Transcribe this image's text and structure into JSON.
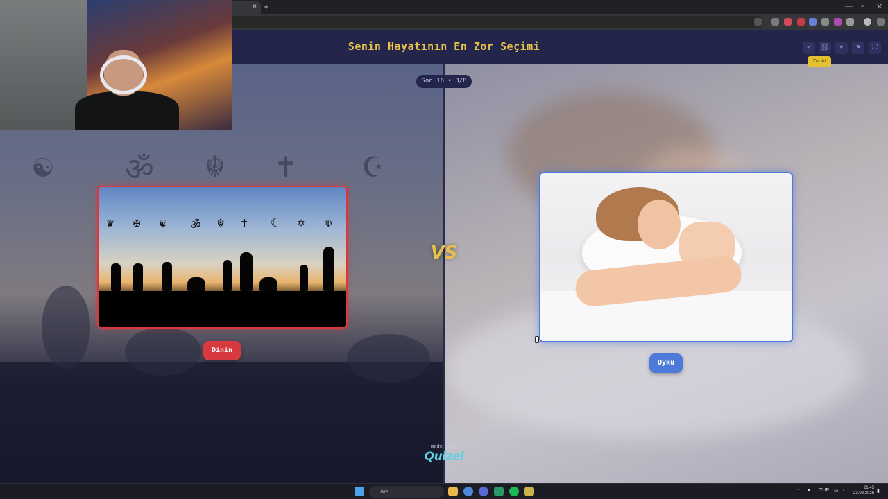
{
  "browser": {
    "tab_close": "×",
    "new_tab": "+",
    "window_controls": [
      "—",
      "▫",
      "✕"
    ]
  },
  "app": {
    "title": "Senin Hayatının En Zor Seçimi",
    "counter": "Son 16 • 3/8",
    "header_buttons": [
      "undo-icon",
      "link-icon",
      "send-icon",
      "flag-icon",
      "fullscreen-icon"
    ],
    "tooltip": "Zor At"
  },
  "left_option": {
    "label": "Dinin",
    "accent": "#d8393f",
    "symbols": [
      "♛",
      "✠",
      "☯",
      "ॐ",
      "☬",
      "✝",
      "☾",
      "✡",
      "☫"
    ]
  },
  "right_option": {
    "label": "Uyku",
    "accent": "#4d7ad8"
  },
  "vs_label": "VS",
  "footer": {
    "made_with": "made with",
    "brand": "Quizei"
  },
  "taskbar": {
    "search_placeholder": "Ara",
    "language": "TUR",
    "time": "21:45",
    "date": "23.03.2026"
  }
}
